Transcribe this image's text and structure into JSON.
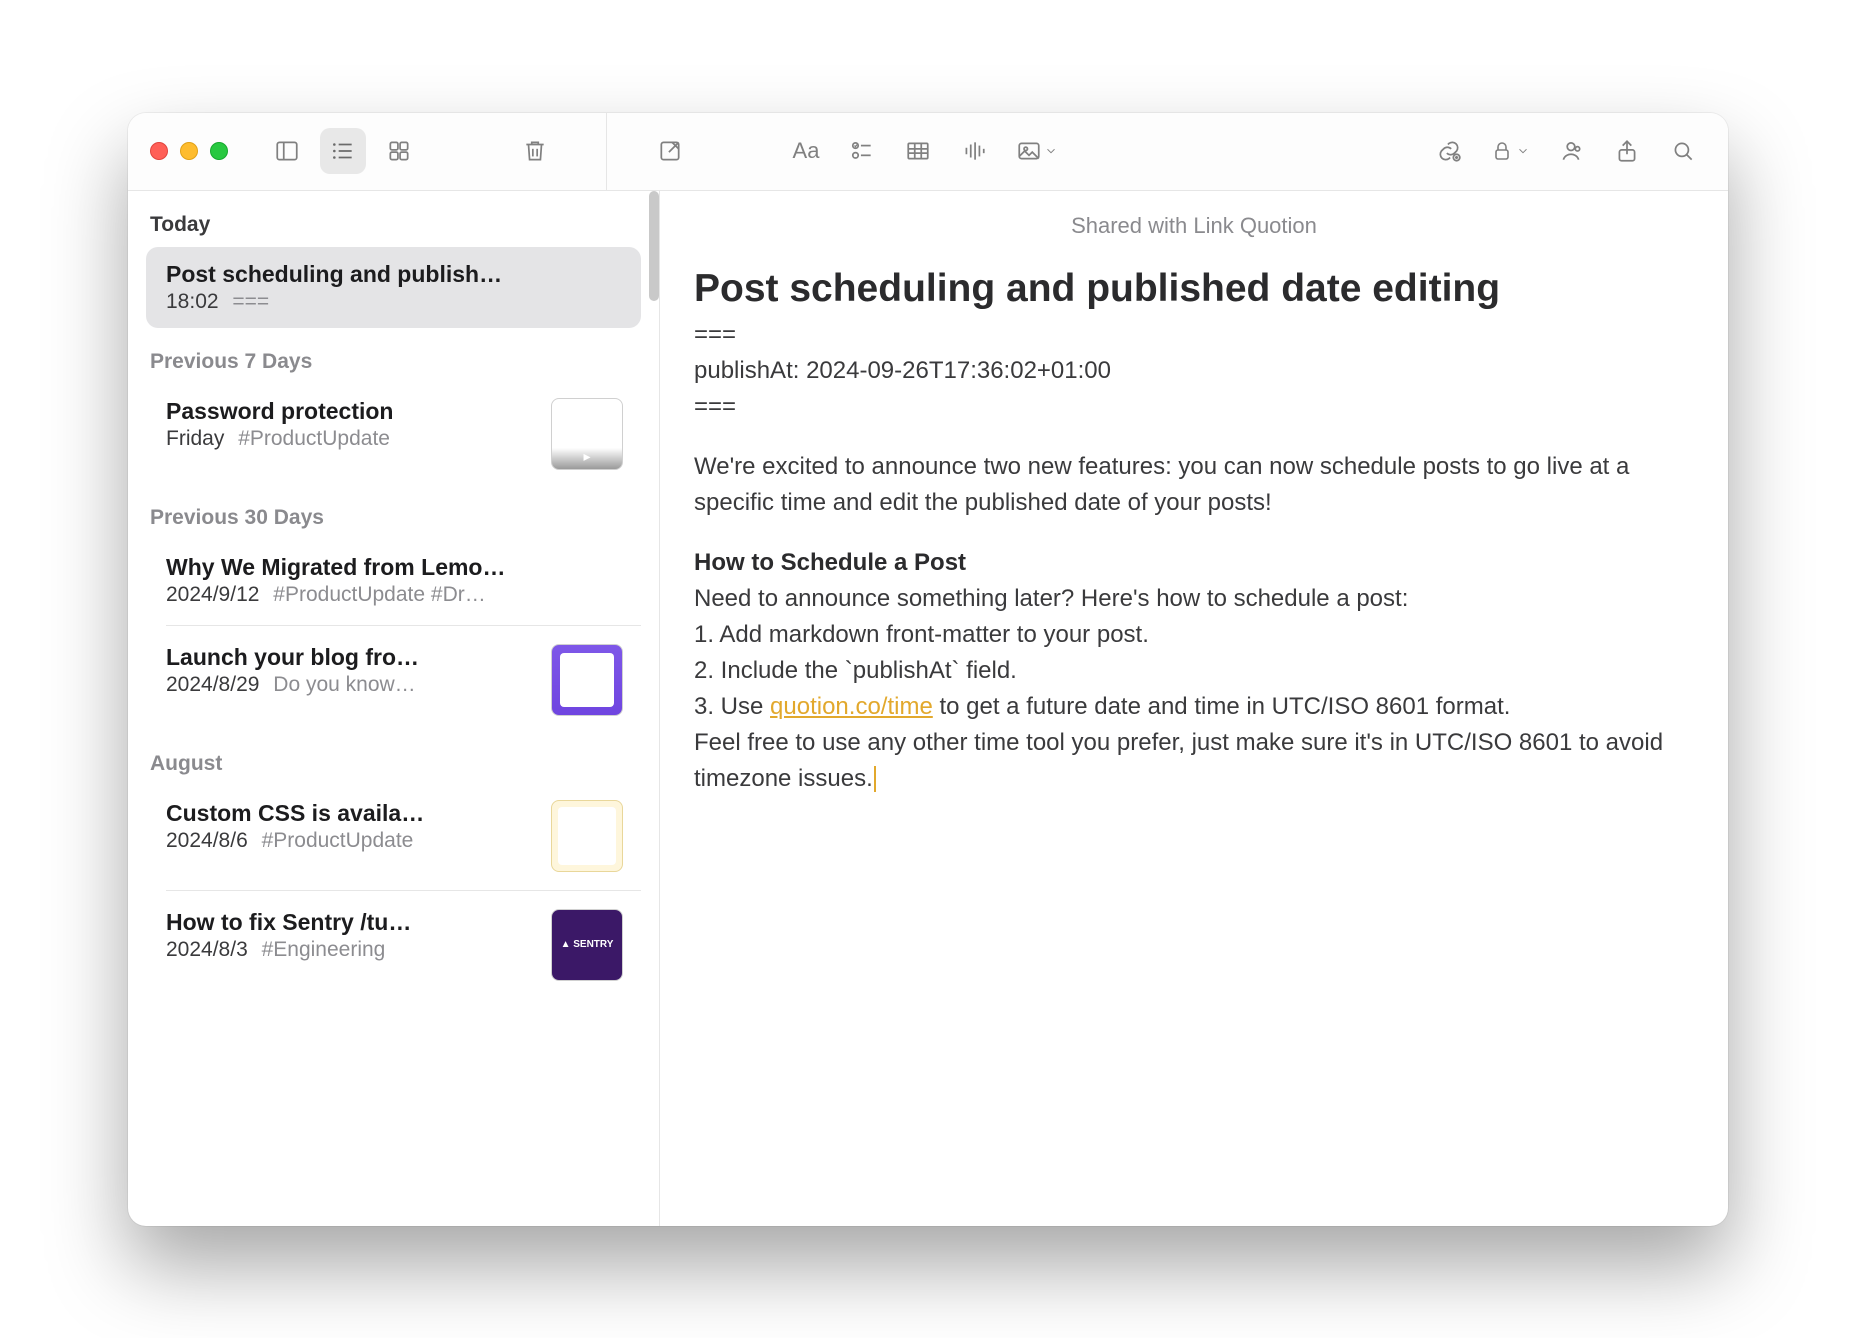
{
  "toolbar": {
    "format_label": "Aa"
  },
  "sidebar": {
    "sections": [
      {
        "label": "Today"
      },
      {
        "label": "Previous 7 Days"
      },
      {
        "label": "Previous 30 Days"
      },
      {
        "label": "August"
      }
    ],
    "items": {
      "today0": {
        "title": "Post scheduling and publish…",
        "time": "18:02",
        "preview": "==="
      },
      "prev7_0": {
        "title": "Password protection",
        "time": "Friday",
        "tags": "#ProductUpdate"
      },
      "prev30_0": {
        "title": "Why We Migrated from Lemo…",
        "time": "2024/9/12",
        "tags": "#ProductUpdate #Dr…"
      },
      "prev30_1": {
        "title": "Launch your blog fro…",
        "time": "2024/8/29",
        "tags": "Do you know…"
      },
      "aug_0": {
        "title": "Custom CSS is availa…",
        "time": "2024/8/6",
        "tags": "#ProductUpdate"
      },
      "aug_1": {
        "title": "How to fix Sentry /tu…",
        "time": "2024/8/3",
        "tags": "#Engineering"
      }
    }
  },
  "editor": {
    "shared_label": "Shared with Link Quotion",
    "title": "Post scheduling and published date editing",
    "front_sep": "===",
    "front_line": "publishAt: 2024-09-26T17:36:02+01:00",
    "intro": "We're excited to announce two new features: you can now schedule posts to go live at a specific time and edit the published date of your posts!",
    "howto_heading": "How to Schedule a Post",
    "howto_intro": "Need to announce something later? Here's how to schedule a post:",
    "step1": "1. Add markdown front-matter to your post.",
    "step2": "2. Include the `publishAt` field.",
    "step3_pre": "3. Use ",
    "step3_link": "quotion.co/time",
    "step3_post": " to get a future date and time in UTC/ISO 8601 format.",
    "closing": "Feel free to use any other time tool you prefer, just make sure it's in UTC/ISO 8601 to avoid timezone issues."
  },
  "thumbs": {
    "sentry_label": "▲ SENTRY"
  }
}
